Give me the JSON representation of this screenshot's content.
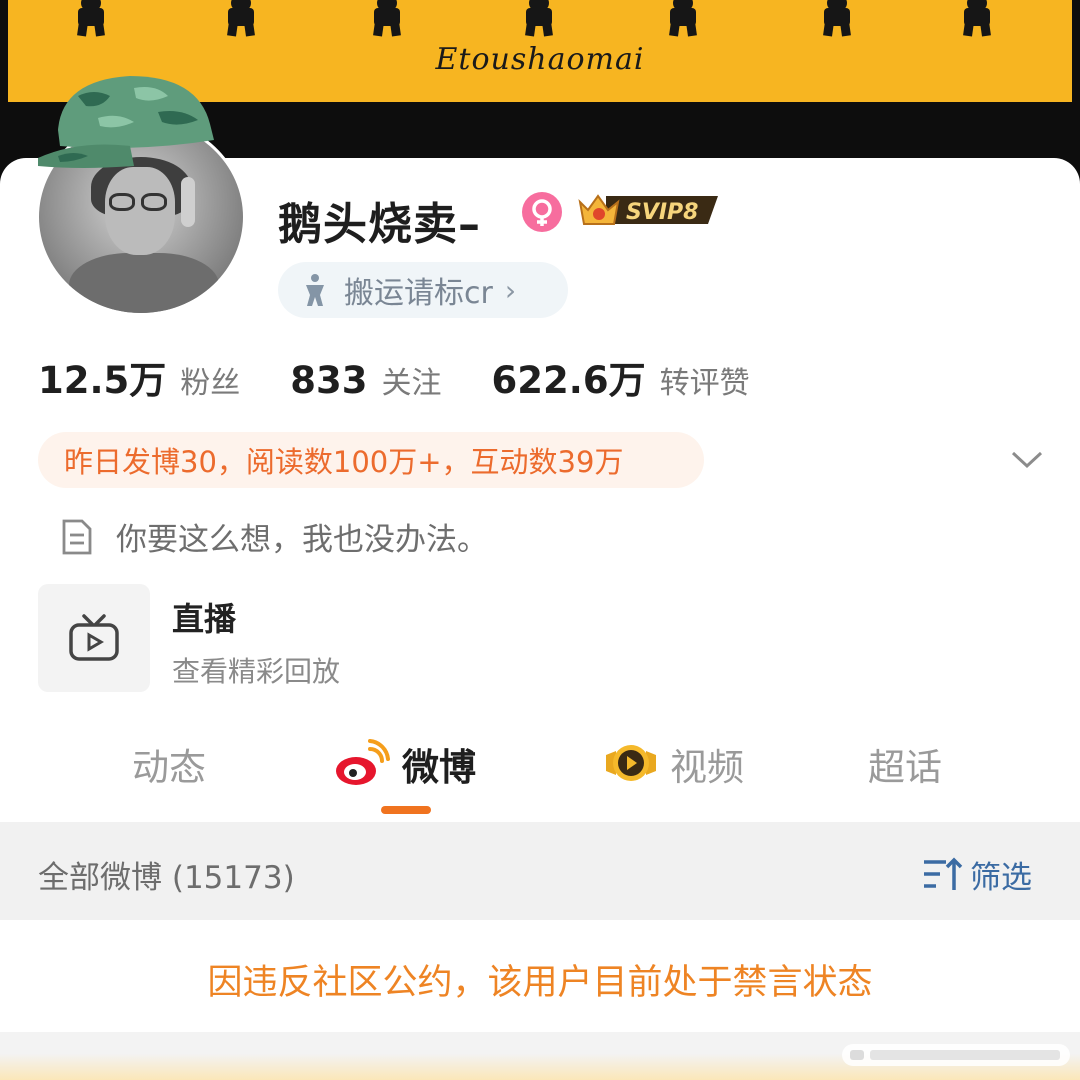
{
  "banner": {
    "text": "Etoushaomai"
  },
  "profile": {
    "username": "鹅头烧卖–",
    "vip_badge": "SVIP8",
    "tag": "搬运请标cr",
    "avatar_icon": "avatar",
    "gender_icon": "female-icon"
  },
  "stats": [
    {
      "num": "12.5万",
      "label": "粉丝"
    },
    {
      "num": "833",
      "label": "关注"
    },
    {
      "num": "622.6万",
      "label": "转评赞"
    }
  ],
  "activity": "昨日发博30，阅读数100万+，互动数39万",
  "bio": "你要这么想，我也没办法。",
  "live": {
    "title": "直播",
    "subtitle": "查看精彩回放"
  },
  "tabs": [
    {
      "label": "动态"
    },
    {
      "label": "微博"
    },
    {
      "label": "视频"
    },
    {
      "label": "超话"
    }
  ],
  "filter_bar": {
    "all_posts": "全部微博 (15173)",
    "filter_label": "筛选"
  },
  "ban_message": "因违反社区公约，该用户目前处于禁言状态",
  "colors": {
    "banner_yellow": "#f7b521",
    "accent_orange": "#f0731f",
    "activity_text": "#ec6b2d",
    "ban_text": "#ee8424",
    "filter_blue": "#3b6ba3",
    "gender_pink": "#f76d9e"
  }
}
